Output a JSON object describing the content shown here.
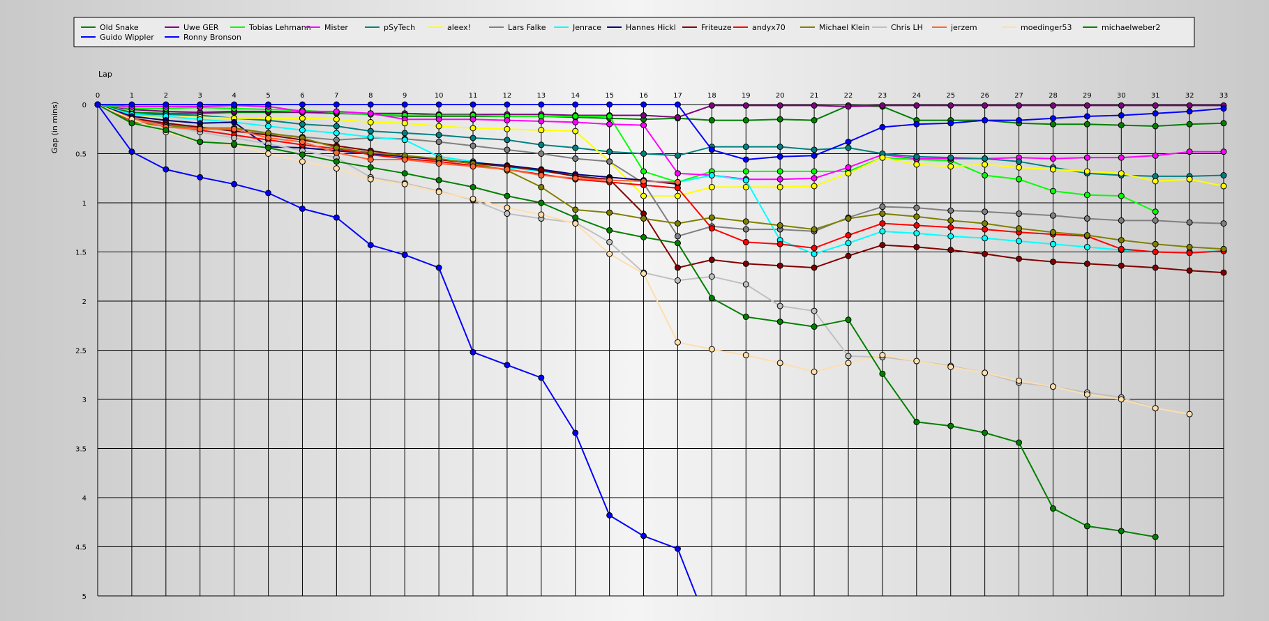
{
  "chart_data": {
    "type": "line",
    "xlabel": "Lap",
    "ylabel": "Gap (in mins)",
    "xlim": [
      0,
      33
    ],
    "ylim": [
      0,
      5
    ],
    "y_inverted": true,
    "grid": true,
    "legend_position": "top",
    "x": [
      0,
      1,
      2,
      3,
      4,
      5,
      6,
      7,
      8,
      9,
      10,
      11,
      12,
      13,
      14,
      15,
      16,
      17,
      18,
      19,
      20,
      21,
      22,
      23,
      24,
      25,
      26,
      27,
      28,
      29,
      30,
      31,
      32,
      33
    ],
    "xticks": [
      0,
      1,
      2,
      3,
      4,
      5,
      6,
      7,
      8,
      9,
      10,
      11,
      12,
      13,
      14,
      15,
      16,
      17,
      18,
      19,
      20,
      21,
      22,
      23,
      24,
      25,
      26,
      27,
      28,
      29,
      30,
      31,
      32,
      33
    ],
    "yticks": [
      0,
      0.5,
      1,
      1.5,
      2,
      2.5,
      3,
      3.5,
      4,
      4.5,
      5
    ],
    "ytick_labels": [
      "0",
      "0.5",
      "1",
      "1.5",
      "2",
      "2.5",
      "3",
      "3.5",
      "4",
      "4.5",
      "5"
    ],
    "series": [
      {
        "name": "Old Snake",
        "color": "#008000",
        "values": [
          0,
          0.08,
          0.09,
          0.09,
          0.08,
          0.08,
          0.08,
          0.09,
          0.1,
          0.12,
          0.12,
          0.12,
          0.12,
          0.12,
          0.13,
          0.14,
          0.15,
          0.14,
          0.16,
          0.16,
          0.15,
          0.16,
          0.01,
          0.02,
          0.16,
          0.16,
          0.16,
          0.19,
          0.2,
          0.2,
          0.21,
          0.22,
          0.2,
          0.19
        ]
      },
      {
        "name": "Uwe GER",
        "color": "#800080",
        "values": [
          0,
          0.05,
          0.07,
          0.08,
          0.07,
          0.07,
          0.08,
          0.08,
          0.09,
          0.09,
          0.1,
          0.1,
          0.1,
          0.1,
          0.11,
          0.11,
          0.11,
          0.13,
          0.01,
          0.01,
          0.01,
          0.01,
          0.02,
          0.01,
          0.01,
          0.01,
          0.01,
          0.01,
          0.01,
          0.01,
          0.01,
          0.01,
          0.01,
          0.01
        ]
      },
      {
        "name": "Tobias Lehmann",
        "color": "#00ff00",
        "values": [
          0,
          0.04,
          0.04,
          0.03,
          0.04,
          0.05,
          0.06,
          0.08,
          0.1,
          0.11,
          0.11,
          0.11,
          0.12,
          0.12,
          0.12,
          0.12,
          0.68,
          0.79,
          0.68,
          0.68,
          0.68,
          0.68,
          0.68,
          0.54,
          0.56,
          0.57,
          0.72,
          0.76,
          0.88,
          0.92,
          0.93,
          1.09,
          null,
          null
        ]
      },
      {
        "name": "Mister",
        "color": "#ff00ff",
        "values": [
          0,
          0.02,
          0.02,
          0.02,
          0.01,
          0.02,
          0.07,
          0.07,
          0.09,
          0.15,
          0.15,
          0.15,
          0.16,
          0.17,
          0.18,
          0.2,
          0.21,
          0.7,
          0.72,
          0.76,
          0.76,
          0.75,
          0.64,
          0.51,
          0.55,
          0.55,
          0.55,
          0.54,
          0.55,
          0.54,
          0.54,
          0.52,
          0.48,
          0.48
        ]
      },
      {
        "name": "pSyTech",
        "color": "#008080",
        "values": [
          0,
          0.1,
          0.1,
          0.11,
          0.14,
          0.16,
          0.2,
          0.22,
          0.27,
          0.29,
          0.31,
          0.34,
          0.36,
          0.41,
          0.44,
          0.48,
          0.5,
          0.52,
          0.43,
          0.43,
          0.43,
          0.46,
          0.44,
          0.5,
          0.53,
          0.54,
          0.55,
          0.58,
          0.64,
          0.7,
          0.72,
          0.73,
          0.73,
          0.72
        ]
      },
      {
        "name": "aleex!",
        "color": "#ffff00",
        "values": [
          0,
          0.13,
          0.13,
          0.13,
          0.14,
          0.14,
          0.14,
          0.15,
          0.18,
          0.19,
          0.22,
          0.24,
          0.25,
          0.26,
          0.27,
          0.58,
          0.93,
          0.93,
          0.84,
          0.84,
          0.84,
          0.83,
          0.7,
          0.54,
          0.61,
          0.63,
          0.61,
          0.64,
          0.66,
          0.68,
          0.7,
          0.78,
          0.76,
          0.83
        ]
      },
      {
        "name": "Lars Falke",
        "color": "#808080",
        "values": [
          0,
          0.15,
          0.2,
          0.24,
          0.24,
          0.3,
          0.33,
          0.36,
          0.34,
          0.35,
          0.38,
          0.42,
          0.46,
          0.5,
          0.55,
          0.58,
          0.8,
          1.34,
          1.24,
          1.27,
          1.27,
          1.29,
          1.15,
          1.04,
          1.05,
          1.08,
          1.09,
          1.11,
          1.13,
          1.16,
          1.18,
          1.18,
          1.2,
          1.21
        ]
      },
      {
        "name": "Jenrace",
        "color": "#00ffff",
        "values": [
          0,
          0.1,
          0.12,
          0.15,
          0.18,
          0.22,
          0.26,
          0.29,
          0.33,
          0.36,
          0.53,
          0.58,
          0.64,
          0.68,
          0.72,
          0.77,
          0.78,
          0.79,
          0.72,
          0.77,
          1.38,
          1.52,
          1.41,
          1.29,
          1.31,
          1.34,
          1.36,
          1.39,
          1.42,
          1.45,
          1.48,
          1.5,
          1.5,
          1.49
        ]
      },
      {
        "name": "Hannes Hickl",
        "color": "#000080",
        "values": [
          0,
          0.12,
          0.16,
          0.19,
          0.18,
          0.43,
          0.44,
          0.47,
          0.5,
          0.53,
          0.56,
          0.59,
          0.62,
          0.66,
          0.71,
          0.74,
          0.77,
          0.81,
          null,
          null,
          null,
          null,
          null,
          null,
          null,
          null,
          null,
          null,
          null,
          null,
          null,
          null,
          null,
          null
        ]
      },
      {
        "name": "Friteuze",
        "color": "#800000",
        "values": [
          0,
          0.14,
          0.19,
          0.23,
          0.27,
          0.31,
          0.36,
          0.42,
          0.47,
          0.52,
          0.56,
          0.6,
          0.63,
          0.67,
          0.73,
          0.76,
          1.11,
          1.66,
          1.58,
          1.62,
          1.64,
          1.66,
          1.54,
          1.43,
          1.45,
          1.48,
          1.52,
          1.57,
          1.6,
          1.62,
          1.64,
          1.66,
          1.69,
          1.71
        ]
      },
      {
        "name": "andyx70",
        "color": "#ff0000",
        "values": [
          0,
          0.16,
          0.21,
          0.26,
          0.31,
          0.36,
          0.41,
          0.45,
          0.51,
          0.55,
          0.58,
          0.62,
          0.66,
          0.71,
          0.76,
          0.79,
          0.82,
          0.85,
          1.26,
          1.4,
          1.42,
          1.46,
          1.33,
          1.21,
          1.23,
          1.25,
          1.27,
          1.3,
          1.32,
          1.34,
          1.47,
          1.5,
          1.51,
          1.49
        ]
      },
      {
        "name": "Michael Klein",
        "color": "#808000",
        "values": [
          0,
          0.18,
          0.22,
          0.24,
          0.24,
          0.29,
          0.34,
          0.44,
          0.49,
          0.52,
          0.55,
          0.6,
          0.67,
          0.84,
          1.07,
          1.1,
          1.16,
          1.21,
          1.15,
          1.19,
          1.23,
          1.27,
          1.16,
          1.11,
          1.14,
          1.18,
          1.21,
          1.26,
          1.3,
          1.33,
          1.38,
          1.42,
          1.45,
          1.47
        ]
      },
      {
        "name": "Chris LH",
        "color": "#c0c0c0",
        "values": [
          0,
          0.15,
          0.22,
          0.28,
          0.34,
          0.4,
          0.47,
          0.54,
          0.74,
          0.8,
          0.88,
          0.97,
          1.11,
          1.16,
          1.2,
          1.4,
          1.71,
          1.79,
          1.75,
          1.83,
          2.05,
          2.1,
          2.56,
          2.57,
          2.61,
          2.66,
          2.73,
          2.83,
          2.87,
          2.93,
          2.98,
          3.09,
          null,
          null
        ]
      },
      {
        "name": "jerzem",
        "color": "#ff6633",
        "values": [
          0,
          0.14,
          0.23,
          0.25,
          0.25,
          0.34,
          0.38,
          0.49,
          0.56,
          0.56,
          0.6,
          0.63,
          0.66,
          0.72,
          0.75,
          0.77,
          0.78,
          0.79,
          null,
          null,
          null,
          null,
          null,
          null,
          null,
          null,
          null,
          null,
          null,
          null,
          null,
          null,
          null,
          null
        ]
      },
      {
        "name": "moedinger53",
        "color": "#ffdead",
        "values": [
          0,
          0.15,
          0.28,
          0.38,
          0.41,
          0.5,
          0.58,
          0.65,
          0.76,
          0.81,
          0.89,
          0.96,
          1.05,
          1.12,
          1.21,
          1.52,
          1.72,
          2.42,
          2.49,
          2.55,
          2.63,
          2.72,
          2.63,
          2.55,
          2.61,
          2.67,
          2.73,
          2.81,
          2.87,
          2.95,
          3.0,
          3.09,
          3.15,
          null
        ]
      },
      {
        "name": "michaelweber2",
        "color": "#008000",
        "values": [
          0,
          0.19,
          0.26,
          0.38,
          0.4,
          0.44,
          0.51,
          0.58,
          0.64,
          0.7,
          0.77,
          0.84,
          0.93,
          1.0,
          1.15,
          1.28,
          1.35,
          1.41,
          1.97,
          2.16,
          2.21,
          2.26,
          2.19,
          2.74,
          3.23,
          3.27,
          3.34,
          3.44,
          4.11,
          4.29,
          4.34,
          4.4,
          null,
          null
        ]
      },
      {
        "name": "Guido Wippler",
        "color": "#0000ff",
        "values": [
          0,
          0,
          0,
          0,
          0,
          0,
          0,
          0,
          0,
          0,
          0,
          0,
          0,
          0,
          0,
          0,
          0,
          0,
          0.46,
          0.56,
          0.53,
          0.52,
          0.38,
          0.23,
          0.2,
          0.19,
          0.16,
          0.16,
          0.14,
          0.12,
          0.11,
          0.09,
          0.07,
          0.04
        ]
      },
      {
        "name": "Ronny Bronson",
        "color": "#0000ff",
        "values": [
          0,
          0.48,
          0.66,
          0.74,
          0.81,
          0.9,
          1.06,
          1.15,
          1.43,
          1.53,
          1.66,
          2.52,
          2.65,
          2.78,
          3.34,
          4.18,
          4.39,
          4.52,
          5.4,
          null,
          null,
          null,
          null,
          null,
          null,
          null,
          null,
          null,
          null,
          null,
          null,
          null,
          null,
          null
        ]
      }
    ]
  }
}
